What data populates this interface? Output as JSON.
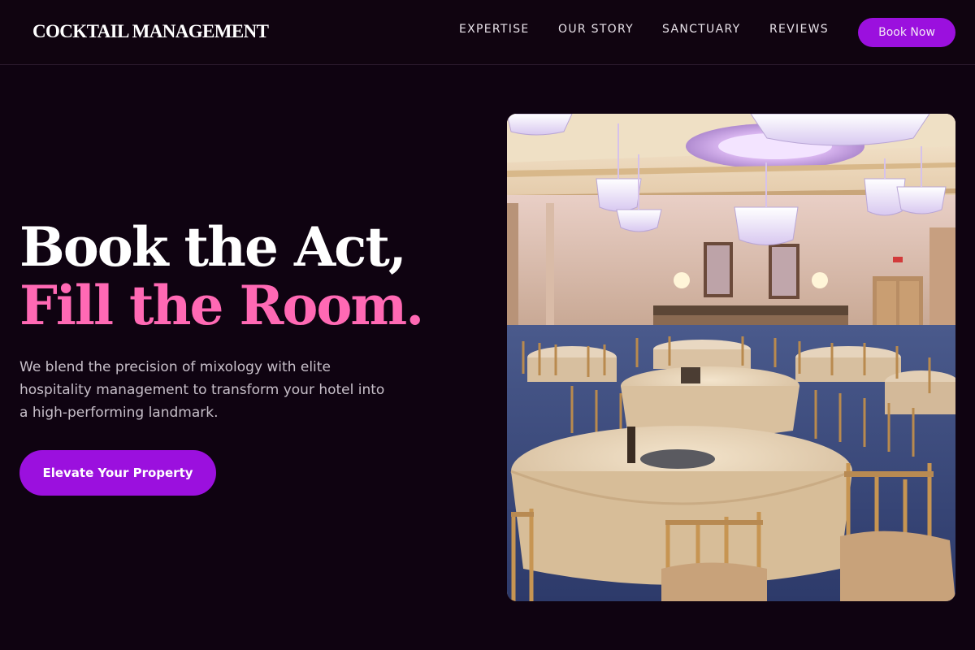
{
  "navbar": {
    "logo": "COCKTAIL MANAGEMENT",
    "links": [
      "EXPERTISE",
      "OUR STORY",
      "SANCTUARY",
      "REVIEWS"
    ],
    "book_label": "Book Now"
  },
  "hero": {
    "headline_line1": "Book the Act,",
    "headline_line2": "Fill the Room.",
    "description": "We blend the precision of mixology with elite hospitality management to transform your hotel into a high-performing landmark.",
    "cta_label": "Elevate Your Property"
  },
  "colors": {
    "background": "#0f0311",
    "accent_purple": "#9b10de",
    "accent_pink": "#ff69b4"
  }
}
